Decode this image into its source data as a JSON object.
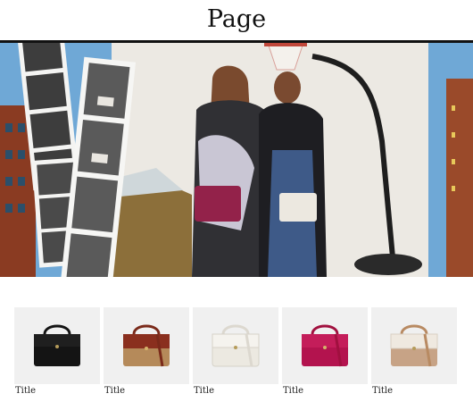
{
  "page": {
    "title": "Page"
  },
  "hero": {
    "description_icon": "photo-booth-strip-hero-image"
  },
  "products": [
    {
      "title": "Title",
      "bag_color": "#141414",
      "strap_color": "#141414",
      "lower_color": "#141414",
      "icon": "black-bag-icon"
    },
    {
      "title": "Title",
      "bag_color": "#8a2f1e",
      "strap_color": "#7a2a1a",
      "lower_color": "#b58a5a",
      "icon": "brown-bag-icon"
    },
    {
      "title": "Title",
      "bag_color": "#ece9e1",
      "strap_color": "#dcd8cf",
      "lower_color": "#ece9e1",
      "icon": "white-bag-icon"
    },
    {
      "title": "Title",
      "bag_color": "#b3134e",
      "strap_color": "#a1103f",
      "lower_color": "#b3134e",
      "icon": "magenta-bag-icon"
    },
    {
      "title": "Title",
      "bag_color": "#efe9e0",
      "strap_color": "#b88a62",
      "lower_color": "#c7a386",
      "icon": "cream-tan-bag-icon"
    }
  ]
}
